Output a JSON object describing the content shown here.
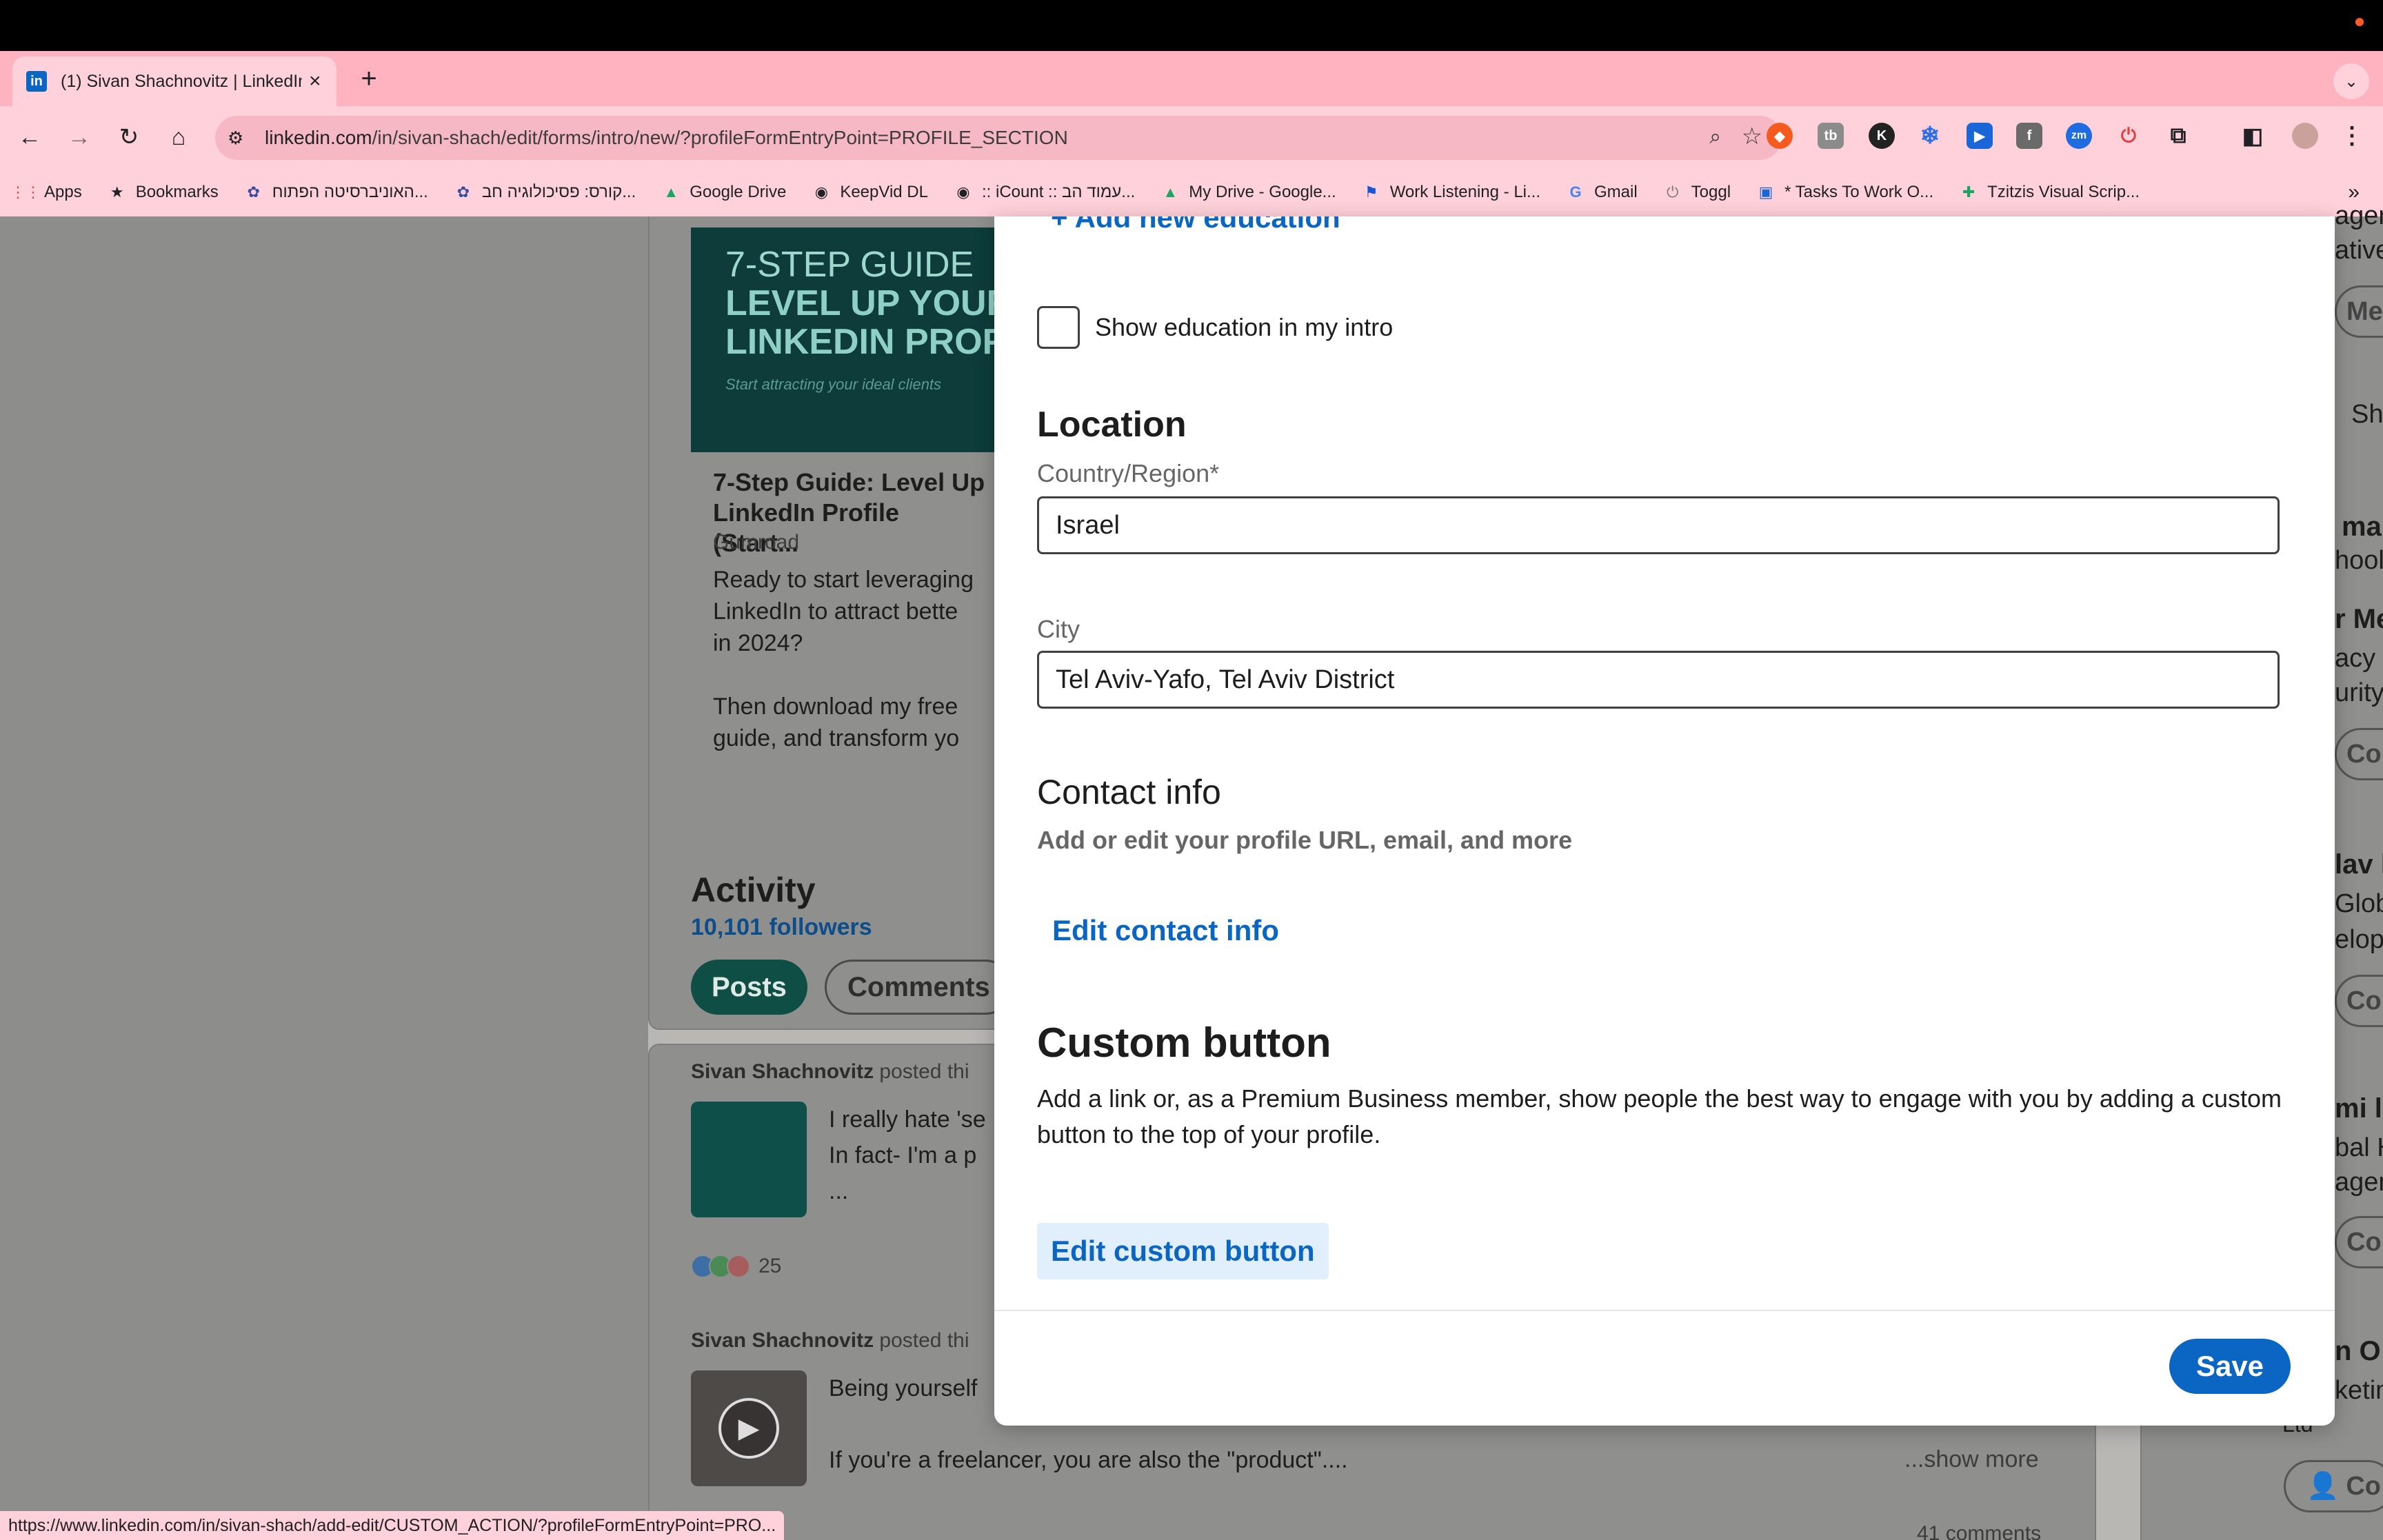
{
  "browser": {
    "tab_title": "(1) Sivan Shachnovitz | LinkedIn",
    "tab_favicon": "in",
    "tab_close": "×",
    "new_tab": "+",
    "url_host": "linkedin.com",
    "url_path": "/in/sivan-shach/edit/forms/intro/new/?profileFormEntryPoint=PROFILE_SECTION",
    "status_url": "https://www.linkedin.com/in/sivan-shach/add-edit/CUSTOM_ACTION/?profileFormEntryPoint=PRO...",
    "bookmarks": [
      {
        "label": "Apps",
        "icon": "apps-grid-icon",
        "glyph": "⋮⋮",
        "color": "#e94235"
      },
      {
        "label": "Bookmarks",
        "icon": "star-icon",
        "glyph": "★",
        "color": "#202124"
      },
      {
        "label": "האוניברסיטה הפתוח...",
        "icon": "university-icon",
        "glyph": "✿",
        "color": "#3b4ba5"
      },
      {
        "label": "קורס: פסיכולוגיה חב...",
        "icon": "university-icon",
        "glyph": "✿",
        "color": "#3b4ba5"
      },
      {
        "label": "Google Drive",
        "icon": "google-drive-icon",
        "glyph": "▲",
        "color": "#1fa463"
      },
      {
        "label": "KeepVid DL",
        "icon": "keepvid-icon",
        "glyph": "◉",
        "color": "#202124"
      },
      {
        "label": ":: iCount :: עמוד הב...",
        "icon": "icount-icon",
        "glyph": "◉",
        "color": "#202124"
      },
      {
        "label": "My Drive - Google...",
        "icon": "google-drive-icon",
        "glyph": "▲",
        "color": "#1fa463"
      },
      {
        "label": "Work Listening - Li...",
        "icon": "flag-icon",
        "glyph": "⚑",
        "color": "#1a55d6"
      },
      {
        "label": "Gmail",
        "icon": "google-icon",
        "glyph": "G",
        "color": "#4285f4"
      },
      {
        "label": "Toggl",
        "icon": "toggl-icon",
        "glyph": "⏻",
        "color": "#777777"
      },
      {
        "label": "* Tasks To Work O...",
        "icon": "trello-icon",
        "glyph": "▣",
        "color": "#1a66d9"
      },
      {
        "label": "Tzitzis Visual Scrip...",
        "icon": "sheets-icon",
        "glyph": "✚",
        "color": "#1ea362"
      }
    ],
    "more_bookmarks": "»"
  },
  "background": {
    "guide": {
      "image_lines": [
        "7-STEP GUIDE",
        "LEVEL UP YOUR",
        "LINKEDIN PROF",
        "Start attracting your ideal clients"
      ],
      "title": "7-Step Guide: Level Up LinkedIn Profile (Start...",
      "source": "Gumroad",
      "description": "Ready to start leveraging\nLinkedIn to attract bette\nin 2024?\n\nThen download my free\nguide, and transform yo"
    },
    "activity": {
      "title": "Activity",
      "followers": "10,101 followers",
      "pill_posts": "Posts",
      "pill_comments": "Comments"
    },
    "posts": [
      {
        "author": "Sivan Shachnovitz",
        "action": "posted thi",
        "text": "I really hate 'se\nIn fact- I'm a p\n..."
      },
      {
        "author": "Sivan Shachnovitz",
        "action": "posted thi",
        "text": "Being yourself\n\nIf you're a freelancer, you are also the \"product\"...."
      }
    ],
    "reactions_count": "25",
    "show_more": "...show more",
    "comments_count": "41 comments",
    "right_column": [
      "ager",
      "ative",
      "Me",
      "Sh",
      "ma",
      "hool",
      "r Me",
      "acy L",
      "urity",
      "Co",
      "lav l",
      "Glob",
      "elopr",
      "Co",
      "mi l",
      "bal H",
      "agen",
      "Co",
      "n O",
      "ketin",
      "Ltd",
      "Co"
    ]
  },
  "modal": {
    "add_education": "+ Add new education",
    "show_education_label": "Show education in my intro",
    "location_heading": "Location",
    "country_label": "Country/Region*",
    "country_value": "Israel",
    "city_label": "City",
    "city_value": "Tel Aviv-Yafo, Tel Aviv District",
    "contact_heading": "Contact info",
    "contact_sub": "Add or edit your profile URL, email, and more",
    "edit_contact": "Edit contact info",
    "custom_heading": "Custom button",
    "custom_desc": "Add a link or, as a Premium Business member, show people the best way to engage with you by adding a custom button to the top of your profile.",
    "edit_custom": "Edit custom button",
    "save_label": "Save"
  },
  "colors": {
    "linkedin_blue": "#0a66c2",
    "tab_pink": "#ffb3c1",
    "toolbar_pink": "#ffd1da",
    "overlay_gray": "#8f8f8d"
  }
}
